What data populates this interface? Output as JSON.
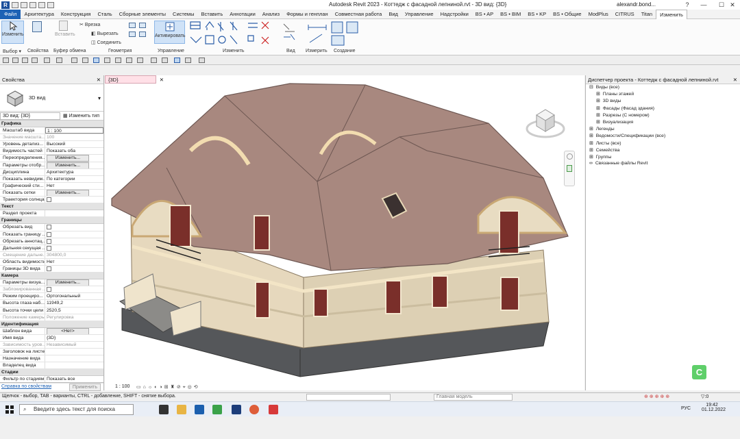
{
  "window": {
    "app_logo": "R",
    "title": "Autodesk Revit 2023 - Коттедж с фасадной лепниной.rvt - 3D вид: {3D}",
    "user": "alexandr.bond...",
    "minimize": "—",
    "maximize": "☐",
    "close": "✕"
  },
  "menu": {
    "tabs": [
      "Файл",
      "Архитектура",
      "Конструкция",
      "Сталь",
      "Сборные элементы",
      "Системы",
      "Вставить",
      "Аннотации",
      "Анализ",
      "Формы и генплан",
      "Совместная работа",
      "Вид",
      "Управление",
      "Надстройки",
      "BS • AP",
      "BS • BIM",
      "BS • KP",
      "BS • Общие",
      "ModPlus",
      "CITRUS",
      "Titan",
      "Изменить"
    ],
    "active": "Изменить"
  },
  "ribbon": {
    "modify_label": "Изменить",
    "properties_label": "Свойства",
    "paste_label": "Вставить",
    "activate_label": "Активировать",
    "cut_label": "Врезка",
    "trim_label": "Вырезать",
    "join_label": "Соединить",
    "groups": {
      "select": "Выбор ▾",
      "properties": "Свойства",
      "clipboard": "Буфер обмена",
      "geometry": "Геометрия",
      "control": "Управление",
      "modify": "Изменить",
      "view": "Вид",
      "measure": "Измерить",
      "create": "Создание"
    }
  },
  "properties": {
    "title": "Свойства",
    "close": "✕",
    "type_name": "3D вид",
    "selector": "3D вид: {3D}",
    "edit_type": "Изменить тип",
    "sections": [
      {
        "name": "Графика",
        "rows": [
          {
            "k": "Масштаб вида",
            "v": "1 : 100",
            "kind": "input"
          },
          {
            "k": "Значение масшта...",
            "v": "100",
            "dim": true
          },
          {
            "k": "Уровень детализ...",
            "v": "Высокий"
          },
          {
            "k": "Видимость частей",
            "v": "Показать оба"
          },
          {
            "k": "Переопределения...",
            "v": "Изменить...",
            "kind": "btn"
          },
          {
            "k": "Параметры отобр...",
            "v": "Изменить...",
            "kind": "btn"
          },
          {
            "k": "Дисциплина",
            "v": "Архитектура"
          },
          {
            "k": "Показать невидим...",
            "v": "По категории"
          },
          {
            "k": "Графический сти...",
            "v": "Нет"
          },
          {
            "k": "Показать сетки",
            "v": "Изменить...",
            "kind": "btn"
          },
          {
            "k": "Траектория солнца",
            "v": "",
            "kind": "chk"
          }
        ]
      },
      {
        "name": "Текст",
        "rows": [
          {
            "k": "Раздел проекта",
            "v": ""
          }
        ]
      },
      {
        "name": "Границы",
        "rows": [
          {
            "k": "Обрезать вид",
            "v": "",
            "kind": "chk"
          },
          {
            "k": "Показать границу ...",
            "v": "",
            "kind": "chk"
          },
          {
            "k": "Обрезать аннотац...",
            "v": "",
            "kind": "chk"
          },
          {
            "k": "Дальняя секущая ...",
            "v": "",
            "kind": "chk"
          },
          {
            "k": "Смещение дальне...",
            "v": "304800,0",
            "dim": true
          },
          {
            "k": "Область видимости",
            "v": "Нет"
          },
          {
            "k": "Границы 3D вида",
            "v": "",
            "kind": "chk"
          }
        ]
      },
      {
        "name": "Камера",
        "rows": [
          {
            "k": "Параметры визуа...",
            "v": "Изменить...",
            "kind": "btn"
          },
          {
            "k": "Заблокированная ...",
            "v": "",
            "kind": "chk",
            "dim": true
          },
          {
            "k": "Режим проециро...",
            "v": "Ортогональный"
          },
          {
            "k": "Высота глаза наб...",
            "v": "11949,2"
          },
          {
            "k": "Высота точки цели",
            "v": "2520,5"
          },
          {
            "k": "Положение камеры",
            "v": "Регулировка",
            "dim": true
          }
        ]
      },
      {
        "name": "Идентификация",
        "rows": [
          {
            "k": "Шаблон вида",
            "v": "<Нет>",
            "kind": "btn"
          },
          {
            "k": "Имя вида",
            "v": "{3D}"
          },
          {
            "k": "Зависимость уров...",
            "v": "Независимый",
            "dim": true
          },
          {
            "k": "Заголовок на листе",
            "v": ""
          },
          {
            "k": "Назначение вида",
            "v": ""
          },
          {
            "k": "Владелец вида",
            "v": ""
          }
        ]
      },
      {
        "name": "Стадии",
        "rows": [
          {
            "k": "Фильтр по стадиям",
            "v": "Показать все"
          }
        ]
      }
    ],
    "help_link": "Справка по свойствам",
    "apply": "Применить"
  },
  "view": {
    "tab_label": "{3D}",
    "tab_close": "✕",
    "scale": "1 : 100",
    "viewcube_front": "Спереди",
    "viewcube_right": "Справа"
  },
  "browser": {
    "title": "Диспетчер проекта - Коттедж с фасадной лепниной.rvt",
    "close": "✕",
    "items": [
      {
        "label": "Виды (все)",
        "level": 0,
        "prefix": "⊟"
      },
      {
        "label": "Планы этажей",
        "level": 1,
        "prefix": "⊞"
      },
      {
        "label": "3D виды",
        "level": 1,
        "prefix": "⊞"
      },
      {
        "label": "Фасады (Фасад здания)",
        "level": 1,
        "prefix": "⊞"
      },
      {
        "label": "Разрезы (С номером)",
        "level": 1,
        "prefix": "⊞"
      },
      {
        "label": "Визуализация",
        "level": 1,
        "prefix": "⊞"
      },
      {
        "label": "Легенды",
        "level": 0,
        "prefix": "⊞"
      },
      {
        "label": "Ведомости/Спецификации (все)",
        "level": 0,
        "prefix": "⊞"
      },
      {
        "label": "Листы (все)",
        "level": 0,
        "prefix": "⊞"
      },
      {
        "label": "Семейства",
        "level": 0,
        "prefix": "⊞"
      },
      {
        "label": "Группы",
        "level": 0,
        "prefix": "⊞"
      },
      {
        "label": "Связанные файлы Revit",
        "level": 0,
        "prefix": "∞"
      }
    ]
  },
  "status": {
    "hint": "Щелчок - выбор, TAB - варианты, CTRL - добавление, SHIFT - снятие выбора.",
    "workset": "Главная модель",
    "filter_count": "0"
  },
  "taskbar": {
    "search_placeholder": "Введите здесь текст для поиска",
    "lang": "РУС",
    "time": "19:42",
    "date": "01.12.2022"
  },
  "colors": {
    "accent": "#1e62b5",
    "roof": "#a8887f",
    "wall": "#e8dcc2",
    "trim": "#f2dcb0",
    "stone": "#55575a"
  }
}
